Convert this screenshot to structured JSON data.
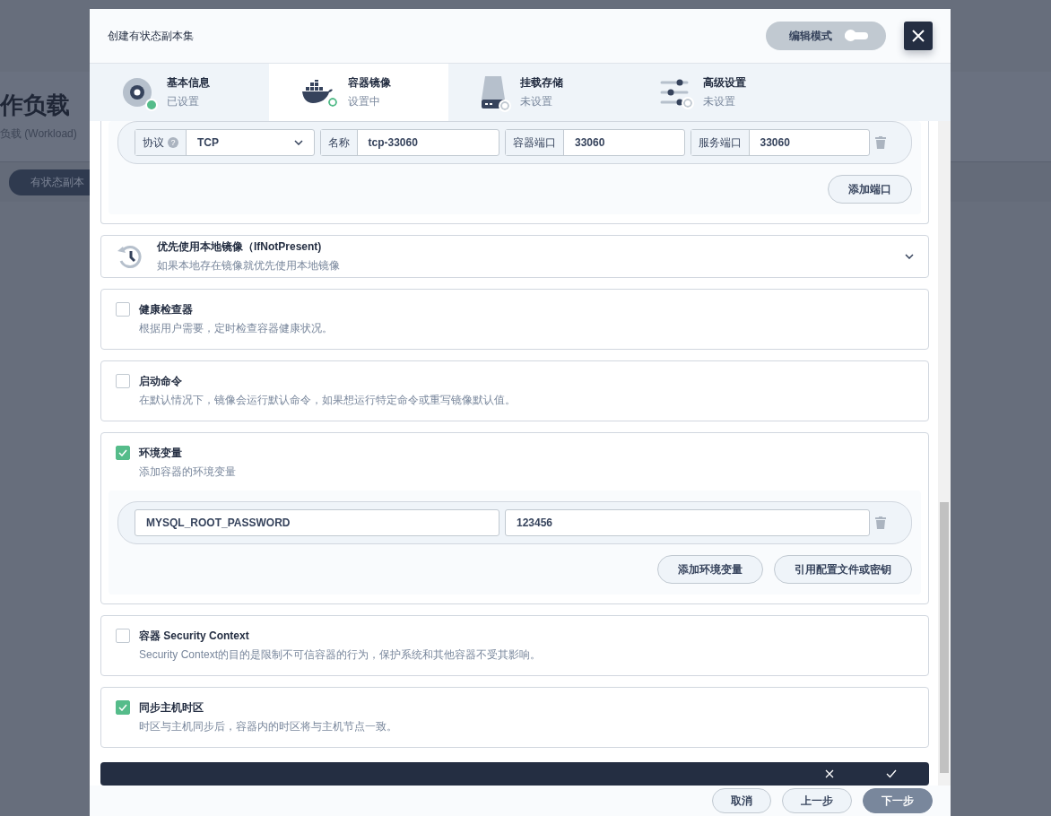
{
  "background_page": {
    "title": "作负载",
    "description": "负载 (Workload)",
    "tab": "有状态副本"
  },
  "dialog": {
    "title": "创建有状态副本集",
    "edit_mode": {
      "label": "编辑模式",
      "on": false
    }
  },
  "steps": [
    {
      "title": "基本信息",
      "status": "已设置",
      "completed": true,
      "selected": false
    },
    {
      "title": "容器镜像",
      "status": "设置中",
      "completed": false,
      "selected": true
    },
    {
      "title": "挂载存储",
      "status": "未设置",
      "completed": false,
      "selected": false
    },
    {
      "title": "高级设置",
      "status": "未设置",
      "completed": false,
      "selected": false
    }
  ],
  "ports": [
    {
      "protocol_label": "协议",
      "protocol_help": "?",
      "protocol": "TCP",
      "name_label": "名称",
      "name": "tcp-33060",
      "container_port_label": "容器端口",
      "container_port": "33060",
      "service_port_label": "服务端口",
      "service_port": "33060"
    }
  ],
  "add_port_button": "添加端口",
  "image_pull_policy": {
    "title": "优先使用本地镜像（IfNotPresent)",
    "description": "如果本地存在镜像就优先使用本地镜像"
  },
  "options": [
    {
      "kind": "plain",
      "title": "健康检查器",
      "description": "根据用户需要，定时检查容器健康状况。",
      "checked": false
    },
    {
      "kind": "plain",
      "title": "启动命令",
      "description": "在默认情况下，镜像会运行默认命令，如果想运行特定命令或重写镜像默认值。",
      "checked": false
    },
    {
      "kind": "env",
      "title": "环境变量",
      "description": "添加容器的环境变量",
      "checked": true,
      "variables": [
        {
          "name": "MYSQL_ROOT_PASSWORD",
          "value": "123456"
        }
      ],
      "buttons": [
        "添加环境变量",
        "引用配置文件或密钥"
      ]
    },
    {
      "kind": "plain",
      "title": "容器 Security Context",
      "description": "Security Context的目的是限制不可信容器的行为，保护系统和其他容器不受其影响。",
      "checked": false
    },
    {
      "kind": "plain",
      "title": "同步主机时区",
      "description": "时区与主机同步后，容器内的时区将与主机节点一致。",
      "checked": true
    }
  ],
  "footer_buttons": [
    {
      "label": "取消",
      "kind": "secondary"
    },
    {
      "label": "上一步",
      "kind": "secondary"
    },
    {
      "label": "下一步",
      "kind": "primary"
    }
  ]
}
